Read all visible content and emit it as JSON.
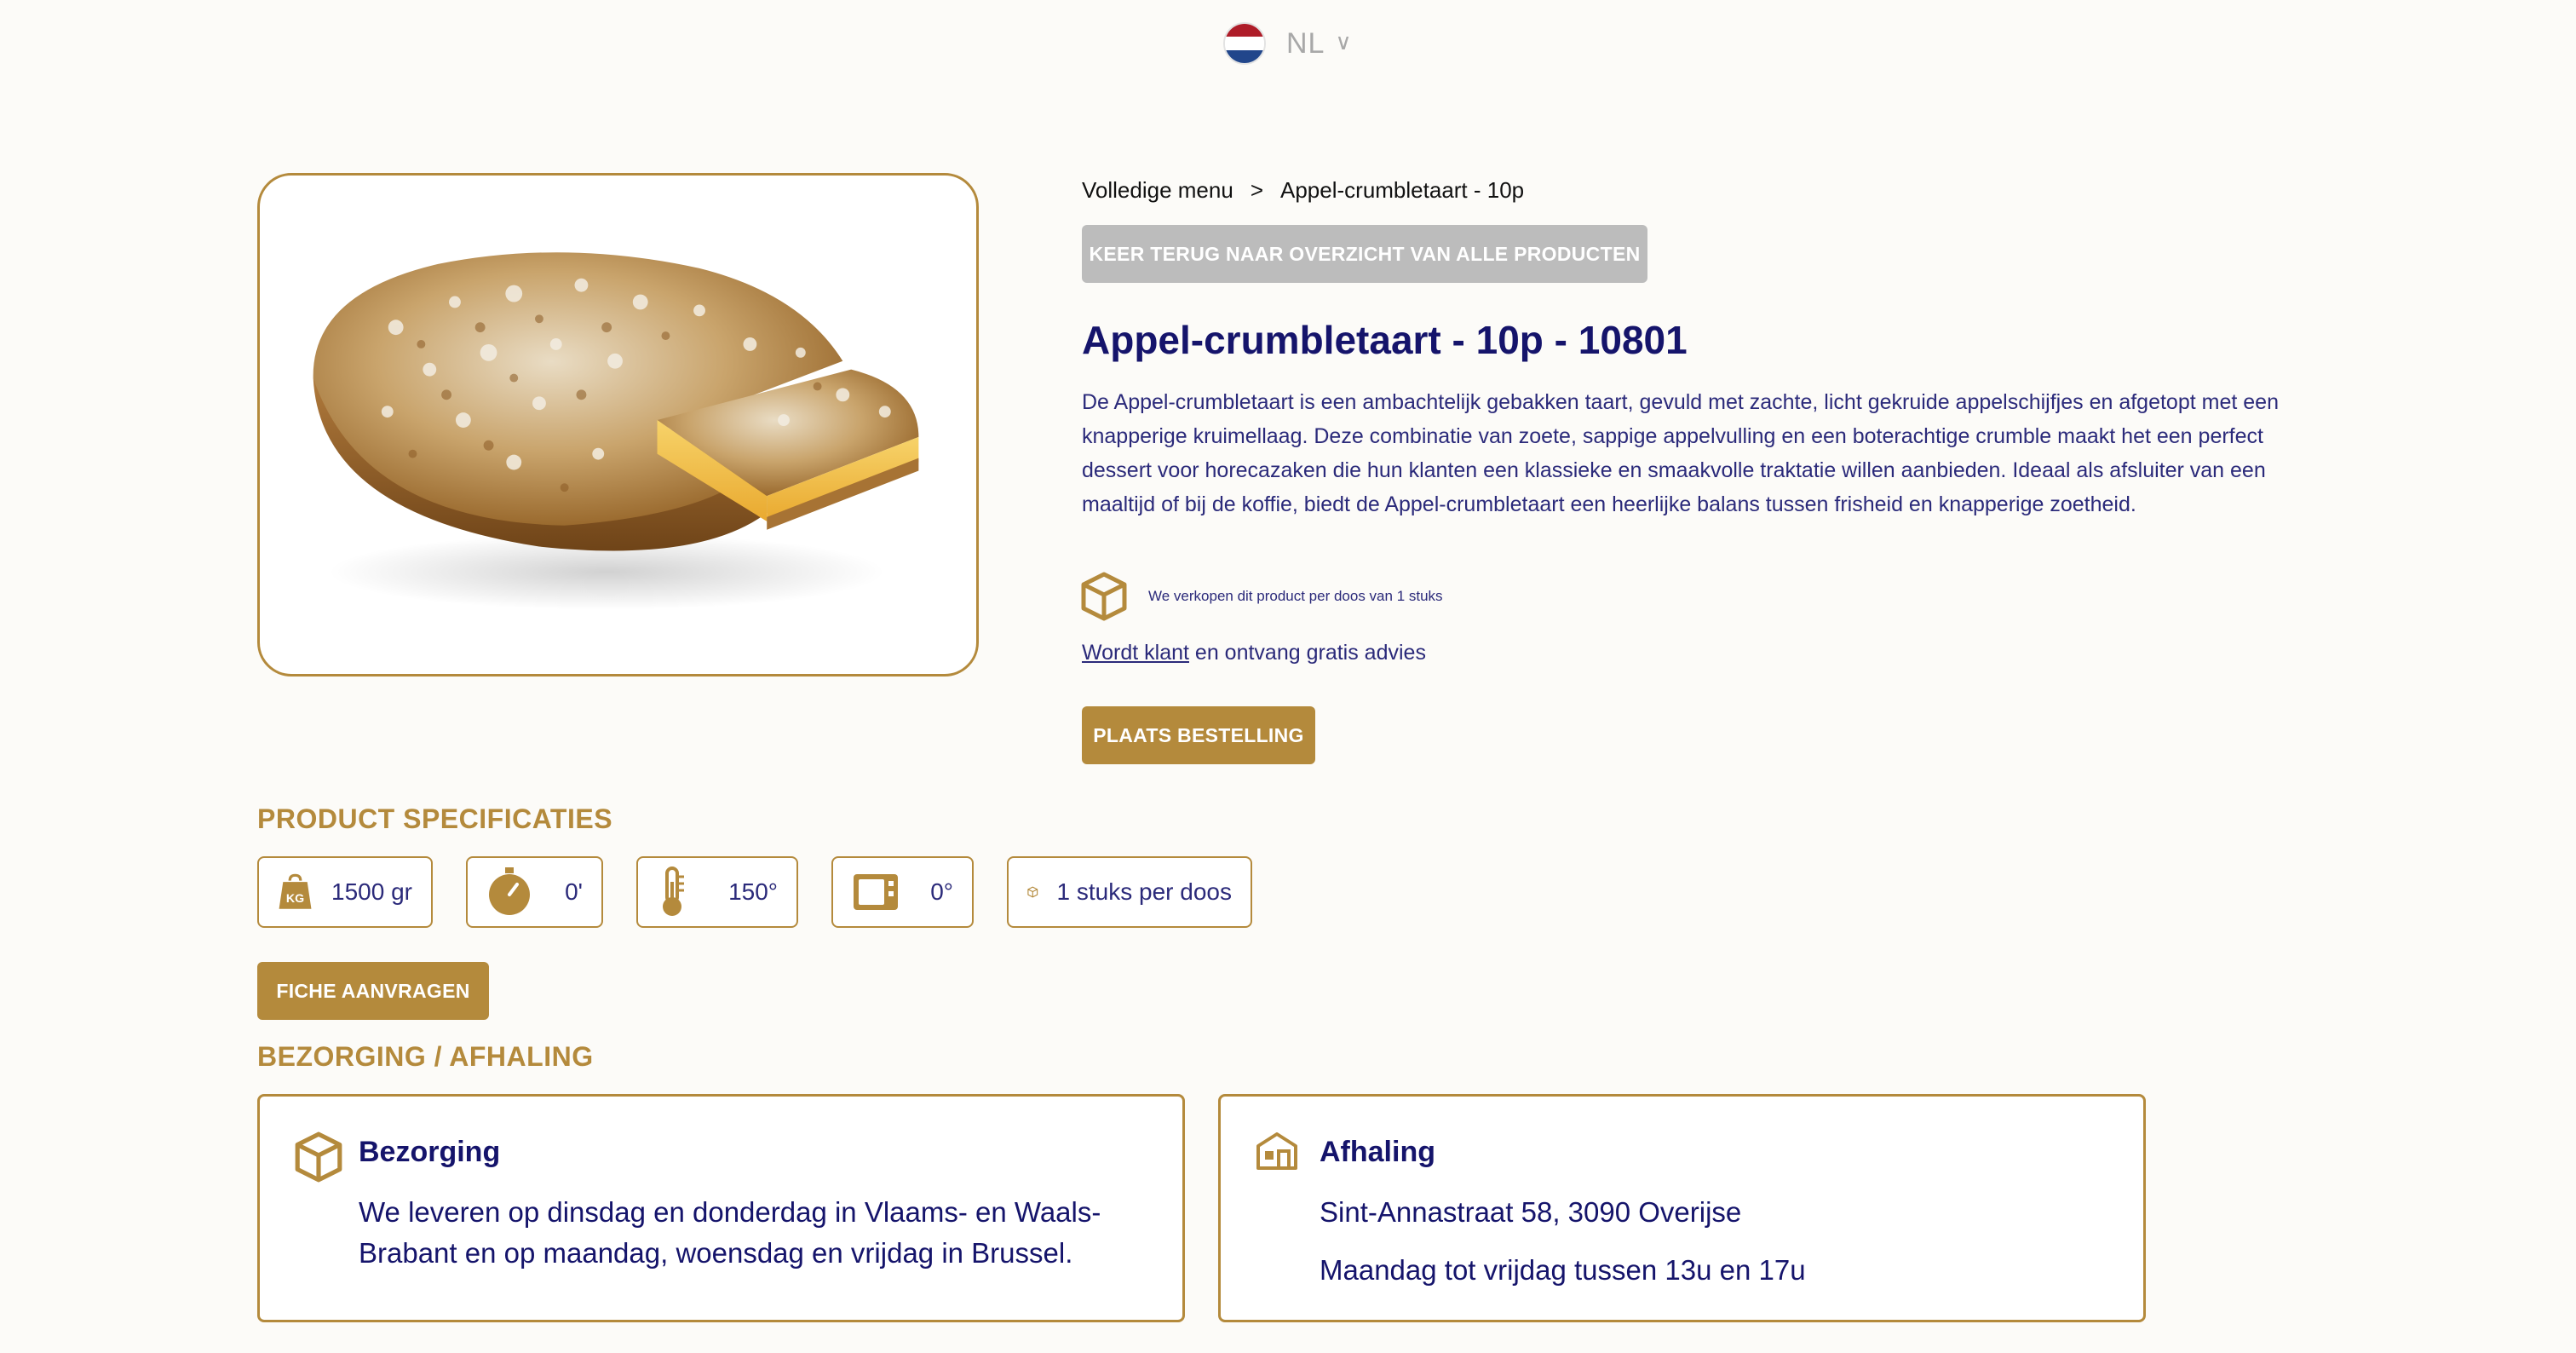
{
  "language": {
    "code": "NL",
    "flag_colors": [
      "#ae1c28",
      "#ffffff",
      "#21468b"
    ]
  },
  "product_image": {
    "alt": "Appel-crumbletaart"
  },
  "breadcrumb": {
    "root": "Volledige menu",
    "separator": ">",
    "current": "Appel-crumbletaart - 10p"
  },
  "back_button": "KEER TERUG NAAR OVERZICHT VAN ALLE PRODUCTEN",
  "title": "Appel-crumbletaart - 10p - 10801",
  "description": "De Appel-crumbletaart is een ambachtelijk gebakken taart, gevuld met zachte, licht gekruide appelschijfjes en afgetopt met een knapperige kruimellaag. Deze combinatie van zoete, sappige appelvulling en een boterachtige crumble maakt het een perfect dessert voor horecazaken die hun klanten een klassieke en smaakvolle traktatie willen aanbieden. Ideaal als afsluiter van een maaltijd of bij de koffie, biedt de Appel-crumbletaart een heerlijke balans tussen frisheid en knapperige zoetheid.",
  "box_info": {
    "icon": "box-icon",
    "text": "We verkopen dit product per doos van 1 stuks"
  },
  "become_client": {
    "link": "Wordt klant",
    "text": " en ontvang gratis advies"
  },
  "order_button": "PLAATS BESTELLING",
  "specs_heading": "PRODUCT SPECIFICATIES",
  "specs": {
    "weight": {
      "icon": "weight-kg-icon",
      "badge": "KG",
      "value": "1500 gr"
    },
    "time": {
      "icon": "stopwatch-icon",
      "value": "0'"
    },
    "temperature": {
      "icon": "thermometer-icon",
      "value": "150°"
    },
    "microwave": {
      "icon": "microwave-icon",
      "value": "0°"
    },
    "per_box": {
      "icon": "box-icon",
      "value": "1 stuks per doos"
    }
  },
  "fiche_button": "FICHE AANVRAGEN",
  "delivery_heading": "BEZORGING / AFHALING",
  "delivery": {
    "icon": "box-icon",
    "title": "Bezorging",
    "text": "We leveren op dinsdag en donderdag in Vlaams- en Waals-Brabant en op maandag, woensdag en vrijdag in Brussel."
  },
  "pickup": {
    "icon": "store-icon",
    "title": "Afhaling",
    "address": "Sint-Annastraat 58, 3090 Overijse",
    "hours": "Maandag tot vrijdag tussen 13u en 17u"
  },
  "colors": {
    "accent": "#b48a3c",
    "navy": "#15146b",
    "background": "#fcfbf8",
    "back_button": "#bcbcbc"
  }
}
